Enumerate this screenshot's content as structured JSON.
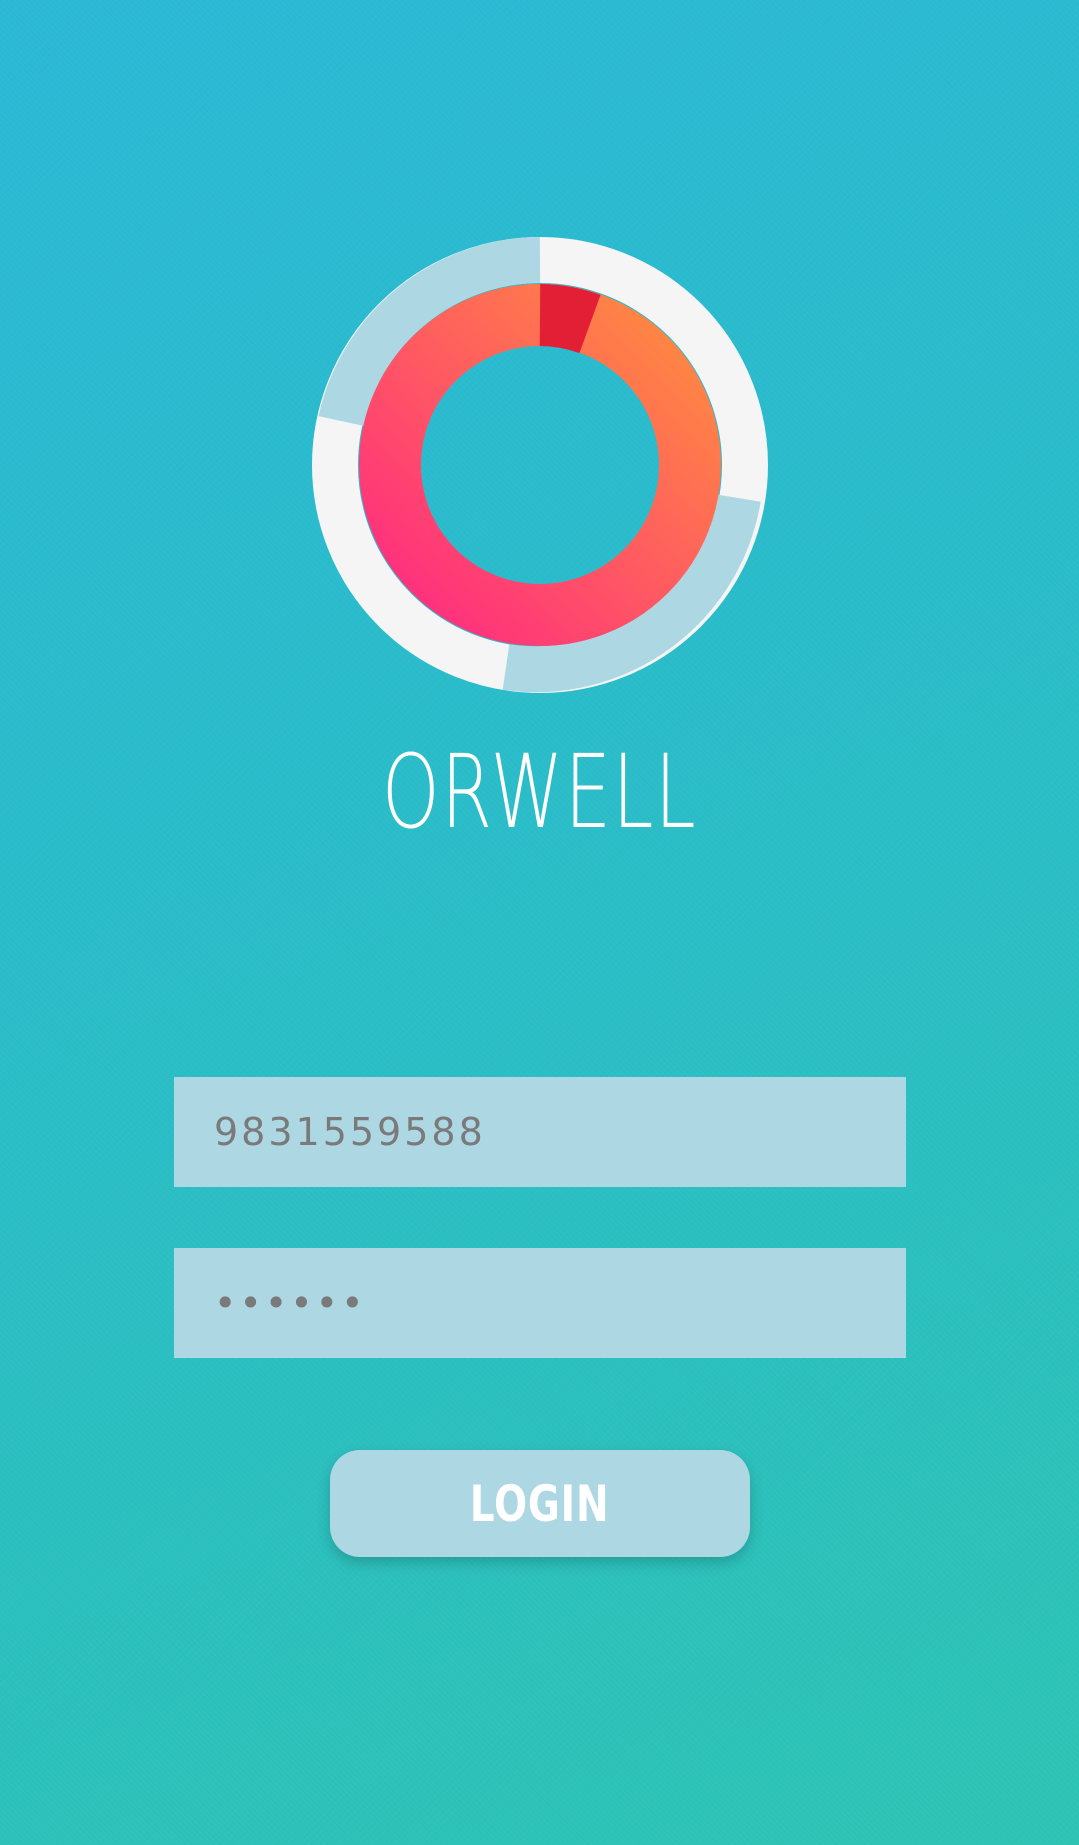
{
  "app": {
    "title": "ORWELL"
  },
  "login_form": {
    "phone_value": "9831559588",
    "password_value": "••••••",
    "login_label": "LOGIN"
  },
  "colors": {
    "background_top": "#2bb9d6",
    "background_bottom": "#2ec4b4",
    "field_fill": "#add8e3",
    "logo_inner_gradient_start": "#ff1f8e",
    "logo_inner_gradient_end": "#ff8c3f",
    "logo_outer_light": "#f5f5f5",
    "logo_outer_blue": "#add8e3"
  },
  "icons": {
    "logo": "ring-logo-icon"
  }
}
